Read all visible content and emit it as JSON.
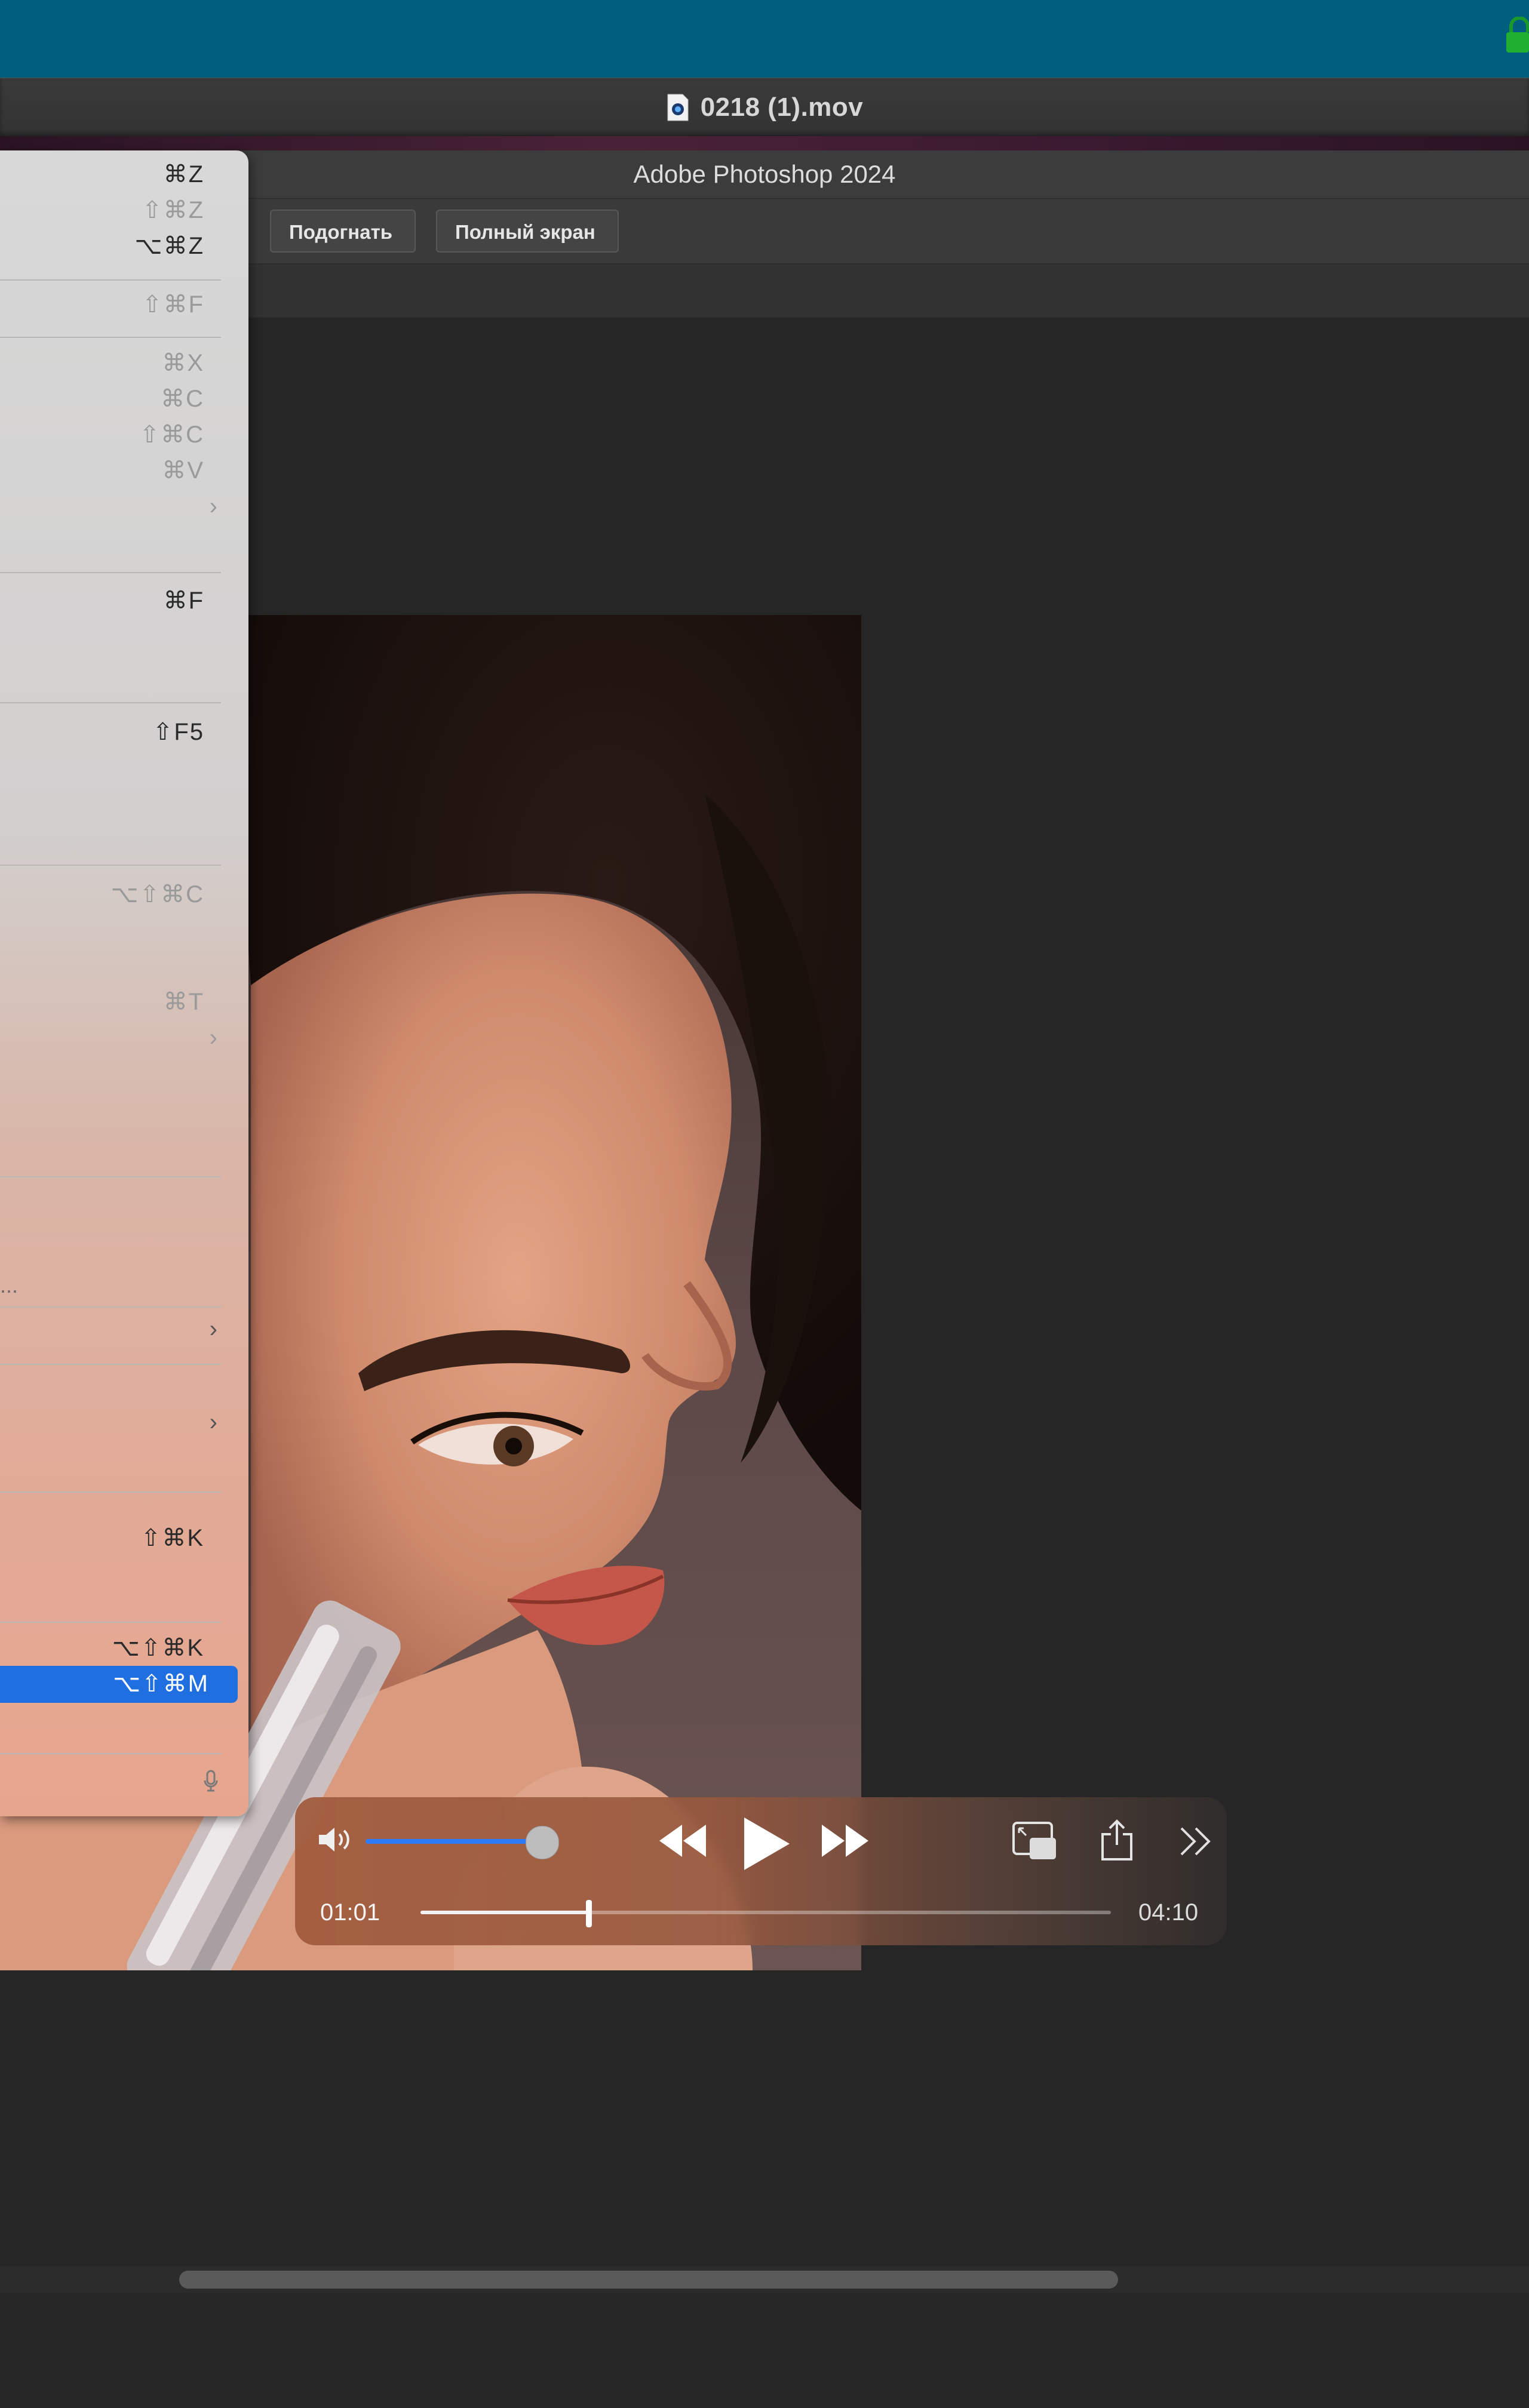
{
  "window": {
    "title": "0218 (1).mov"
  },
  "photoshop": {
    "title": "Adobe Photoshop 2024",
    "options_bar": {
      "fit_label": "Подогнать",
      "fullscreen_label": "Полный экран"
    }
  },
  "edit_menu": {
    "shortcuts": [
      {
        "text": "⌘Z",
        "enabled": true
      },
      {
        "text": "⇧⌘Z",
        "enabled": false
      },
      {
        "text": "⌥⌘Z",
        "enabled": true
      },
      {
        "text": "⇧⌘F",
        "enabled": false
      },
      {
        "text": "⌘X",
        "enabled": false
      },
      {
        "text": "⌘C",
        "enabled": false
      },
      {
        "text": "⇧⌘C",
        "enabled": false
      },
      {
        "text": "⌘V",
        "enabled": false
      },
      {
        "text": "⌘F",
        "enabled": true
      },
      {
        "text": "⇧F5",
        "enabled": true
      },
      {
        "text": "⌥⇧⌘C",
        "enabled": false
      },
      {
        "text": "⌘T",
        "enabled": false
      },
      {
        "text": "⇧⌘K",
        "enabled": true
      },
      {
        "text": "⌥⇧⌘K",
        "enabled": true
      },
      {
        "text": "⌥⇧⌘M",
        "enabled": true,
        "highlighted": true
      }
    ],
    "edge_ellipsis": "..."
  },
  "icons": {
    "lock": "lock-icon",
    "document": "quicktime-document-icon",
    "volume": "volume-icon",
    "rewind": "rewind-icon",
    "play": "play-icon",
    "fast_forward": "fast-forward-icon",
    "pip": "picture-in-picture-icon",
    "share": "share-icon",
    "more": "more-icon",
    "dictation": "microphone-icon",
    "submenu": "chevron-right-icon"
  },
  "player": {
    "elapsed": "01:01",
    "total": "04:10",
    "progress": 0.244,
    "volume": 0.95
  },
  "colors": {
    "desktop": "#005e7e",
    "highlight": "#1f6fe0",
    "volume_fill": "#2b7cf6"
  }
}
